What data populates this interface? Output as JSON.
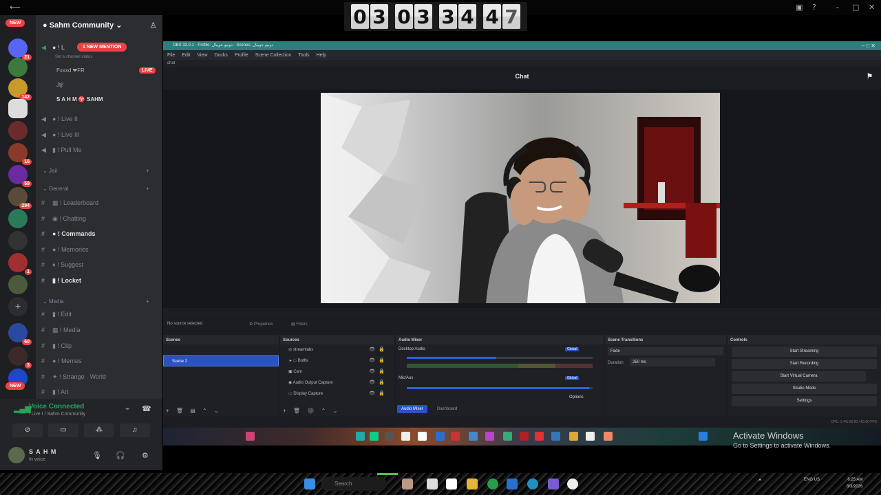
{
  "timer": {
    "digits": [
      "0",
      "3",
      "0",
      "3",
      "3",
      "4",
      "4",
      "7"
    ]
  },
  "discord": {
    "new_label": "NEW",
    "server_name": "Sahm Community",
    "new_mention": "1 NEW MENTION",
    "set_status": "Set a channel status",
    "live_badge": "LIVE",
    "voice_users": [
      "Ϝxxxd ❤FR",
      "Jtj!",
      "S A H M   ♈ SAHM"
    ],
    "channels_top": [
      "! Live II",
      "! Live III",
      "! Pull Me"
    ],
    "category_jail": "Jail",
    "category_general": "General",
    "general_channels": [
      {
        "label": "! Leaderboard",
        "bold": false
      },
      {
        "label": "! Chatting",
        "bold": false
      },
      {
        "label": "! Commands",
        "bold": true
      },
      {
        "label": "! Memories",
        "bold": false
      },
      {
        "label": "! Suggest",
        "bold": false
      },
      {
        "label": "! Locket",
        "bold": true
      }
    ],
    "category_media": "Media",
    "media_channels": [
      "! Edit",
      "! Media",
      "! Clip",
      "! Memes",
      "! Strange · World",
      "! Art"
    ],
    "server_badges": [
      "21",
      "142",
      "16",
      "59",
      "294",
      "1",
      "60",
      "3"
    ],
    "voice_connected": "Voice Connected",
    "voice_channel": "! Live I / Sahm Community",
    "user_name": "S A H M",
    "user_status": "In voice"
  },
  "obs": {
    "title": "OBS 32.0.1 - Profile: دوبيو جوبيال - Scenes: دوبيو جوبيال",
    "menu": [
      "File",
      "Edit",
      "View",
      "Docks",
      "Profile",
      "Scene Collection",
      "Tools",
      "Help"
    ],
    "dock_tab": "chat",
    "chat_title": "Chat",
    "no_source": "No source selected",
    "properties": "Properties",
    "filters": "Filters",
    "scenes_title": "Scenes",
    "scenes": [
      "",
      "Scene 2"
    ],
    "sources_title": "Sources",
    "sources": [
      "streamlabs",
      "Botfix",
      "Cam",
      "Audio Output Capture",
      "Display Capture"
    ],
    "mixer_title": "Audio Mixer",
    "mixer_channels": [
      "Desktop Audio",
      "Mic/Aux"
    ],
    "global_label": "Global",
    "mixer_tab_active": "Audio Mixer",
    "mixer_tab_other": "Dashboard",
    "options": "Options",
    "transitions_title": "Scene Transitions",
    "transition_value": "Fade",
    "duration_label": "Duration",
    "duration_value": "250 ms",
    "controls_title": "Controls",
    "controls": [
      "Start Streaming",
      "Start Recording",
      "Start Virtual Camera",
      "Studio Mode",
      "Settings"
    ],
    "status": "CPU: 2.4%   60.00 / 60.00 FPS"
  },
  "activate": {
    "line1": "Activate Windows",
    "line2": "Go to Settings to activate Windows."
  },
  "host_taskbar": {
    "search_label": "Search",
    "lang": "ENG\nUS",
    "time": "6:25 AM",
    "date": "8/3/2026"
  }
}
